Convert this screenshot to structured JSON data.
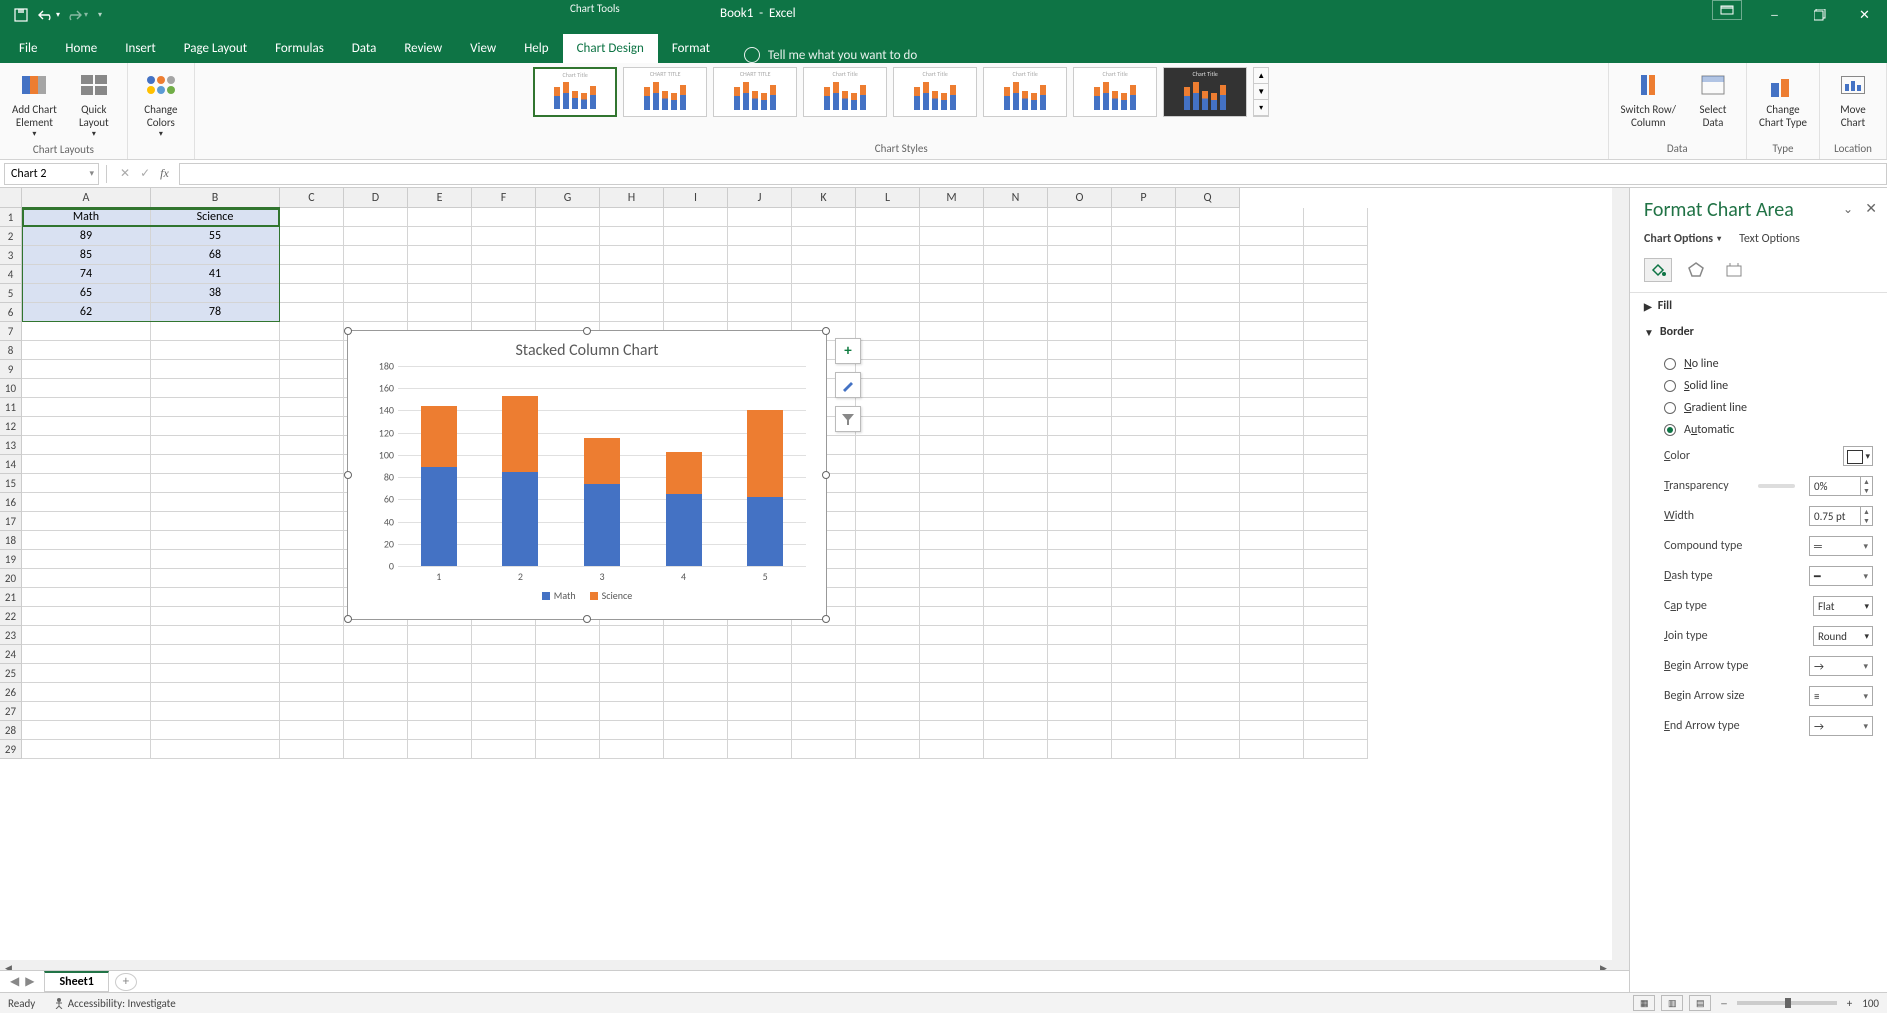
{
  "app": {
    "name": "Excel",
    "document": "Book1",
    "chart_tools": "Chart Tools"
  },
  "qat": {
    "save": "Save",
    "undo": "Undo",
    "redo": "Redo"
  },
  "tabs": {
    "file": "File",
    "home": "Home",
    "insert": "Insert",
    "page_layout": "Page Layout",
    "formulas": "Formulas",
    "data": "Data",
    "review": "Review",
    "view": "View",
    "help": "Help",
    "chart_design": "Chart Design",
    "format": "Format",
    "tell_me": "Tell me what you want to do"
  },
  "ribbon": {
    "chart_layouts": {
      "add_element": "Add Chart\nElement",
      "quick_layout": "Quick\nLayout",
      "group": "Chart Layouts"
    },
    "colors": {
      "change_colors": "Change\nColors"
    },
    "styles_group": "Chart Styles",
    "data": {
      "switch": "Switch Row/\nColumn",
      "select": "Select\nData",
      "group": "Data"
    },
    "type": {
      "change": "Change\nChart Type",
      "group": "Type"
    },
    "location": {
      "move": "Move\nChart",
      "group": "Location"
    }
  },
  "name_box": "Chart 2",
  "columns": [
    "A",
    "B",
    "C",
    "D",
    "E",
    "F",
    "G",
    "H",
    "I",
    "J",
    "K",
    "L",
    "M",
    "N",
    "O",
    "P",
    "Q"
  ],
  "data_headers": {
    "A": "Math",
    "B": "Science"
  },
  "data_rows": [
    {
      "A": "89",
      "B": "55"
    },
    {
      "A": "85",
      "B": "68"
    },
    {
      "A": "74",
      "B": "41"
    },
    {
      "A": "65",
      "B": "38"
    },
    {
      "A": "62",
      "B": "78"
    }
  ],
  "chart_data": {
    "type": "bar",
    "title": "Stacked Column Chart",
    "categories": [
      "1",
      "2",
      "3",
      "4",
      "5"
    ],
    "series": [
      {
        "name": "Math",
        "values": [
          89,
          85,
          74,
          65,
          62
        ],
        "color": "#4472C4"
      },
      {
        "name": "Science",
        "values": [
          55,
          68,
          41,
          38,
          78
        ],
        "color": "#ED7D31"
      }
    ],
    "ylim": [
      0,
      180
    ],
    "yticks": [
      0,
      20,
      40,
      60,
      80,
      100,
      120,
      140,
      160,
      180
    ],
    "xlabel": "",
    "ylabel": ""
  },
  "chart_buttons": {
    "plus": "+",
    "brush": "Chart Styles",
    "filter": "Chart Filters"
  },
  "format_pane": {
    "title": "Format Chart Area",
    "subtab_options": "Chart Options",
    "subtab_text": "Text Options",
    "fill_hdr": "Fill",
    "border_hdr": "Border",
    "no_line": "No line",
    "solid_line": "Solid line",
    "gradient_line": "Gradient line",
    "automatic": "Automatic",
    "color": "Color",
    "transparency": "Transparency",
    "transparency_val": "0%",
    "width": "Width",
    "width_val": "0.75 pt",
    "compound": "Compound type",
    "dash": "Dash type",
    "cap": "Cap type",
    "cap_val": "Flat",
    "join": "Join type",
    "join_val": "Round",
    "begin_arrow_type": "Begin Arrow type",
    "begin_arrow_size": "Begin Arrow size",
    "end_arrow_type": "End Arrow type"
  },
  "sheet": {
    "name": "Sheet1"
  },
  "status": {
    "ready": "Ready",
    "accessibility": "Accessibility: Investigate",
    "zoom": "100"
  }
}
